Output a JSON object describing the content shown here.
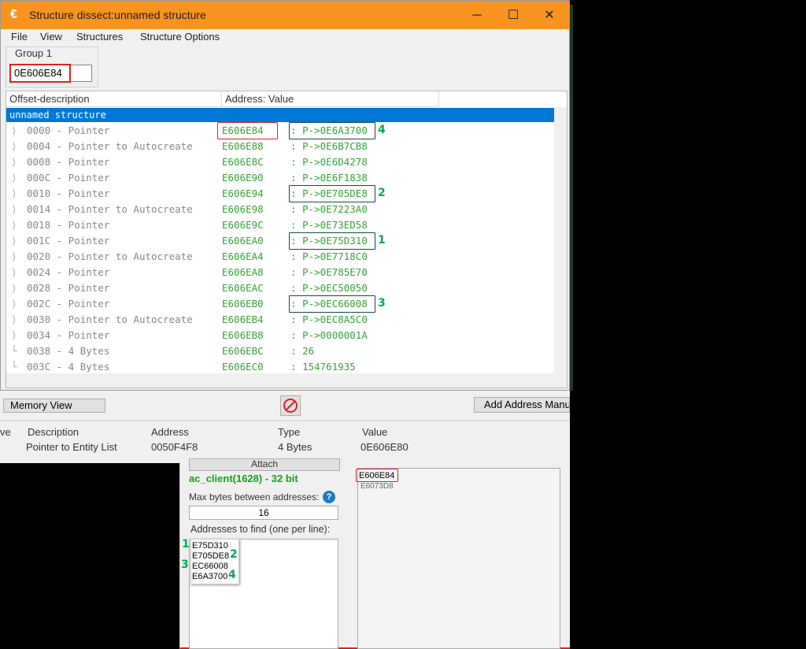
{
  "window": {
    "title": "Structure dissect:unnamed structure",
    "app_icon": "cheat-engine-icon",
    "min_glyph": "─",
    "max_glyph": "☐",
    "close_glyph": "✕"
  },
  "menu": [
    "File",
    "View",
    "Structures",
    "Structure Options"
  ],
  "group": {
    "label": "Group 1",
    "address": "0E606E84"
  },
  "grid": {
    "headers": [
      "Offset-description",
      "Address: Value"
    ],
    "selected_row": "unnamed structure",
    "rows": [
      {
        "tree": "⟩",
        "desc": "0000 - Pointer",
        "addr": "E606E84",
        "val": "P->0E6A3700"
      },
      {
        "tree": "⟩",
        "desc": "0004 - Pointer to Autocreate",
        "addr": "E606E88",
        "val": "P->0E6B7CB8"
      },
      {
        "tree": "⟩",
        "desc": "0008 - Pointer",
        "addr": "E606E8C",
        "val": "P->0E6D4278"
      },
      {
        "tree": "⟩",
        "desc": "000C - Pointer",
        "addr": "E606E90",
        "val": "P->0E6F1838"
      },
      {
        "tree": "⟩",
        "desc": "0010 - Pointer",
        "addr": "E606E94",
        "val": "P->0E705DE8"
      },
      {
        "tree": "⟩",
        "desc": "0014 - Pointer to Autocreate",
        "addr": "E606E98",
        "val": "P->0E7223A0"
      },
      {
        "tree": "⟩",
        "desc": "0018 - Pointer",
        "addr": "E606E9C",
        "val": "P->0E73ED58"
      },
      {
        "tree": "⟩",
        "desc": "001C - Pointer",
        "addr": "E606EA0",
        "val": "P->0E75D310"
      },
      {
        "tree": "⟩",
        "desc": "0020 - Pointer to Autocreate",
        "addr": "E606EA4",
        "val": "P->0E7718C0"
      },
      {
        "tree": "⟩",
        "desc": "0024 - Pointer",
        "addr": "E606EA8",
        "val": "P->0E785E70"
      },
      {
        "tree": "⟩",
        "desc": "0028 - Pointer",
        "addr": "E606EAC",
        "val": "P->0EC50050"
      },
      {
        "tree": "⟩",
        "desc": "002C - Pointer",
        "addr": "E606EB0",
        "val": "P->0EC66008"
      },
      {
        "tree": "⟩",
        "desc": "0030 - Pointer to Autocreate",
        "addr": "E606EB4",
        "val": "P->0EC8A5C0"
      },
      {
        "tree": "⟩",
        "desc": "0034 - Pointer",
        "addr": "E606EB8",
        "val": "P->0000001A"
      },
      {
        "tree": "└",
        "desc": "0038 - 4 Bytes",
        "addr": "E606EBC",
        "val": "26"
      },
      {
        "tree": "└",
        "desc": "003C - 4 Bytes",
        "addr": "E606EC0",
        "val": "154761935"
      }
    ],
    "addr_sep": ":",
    "annotations": [
      "4",
      "2",
      "1",
      "3"
    ]
  },
  "main": {
    "memory_view_label": "Memory View",
    "add_address_label": "Add Address Manually",
    "headers": [
      "ve",
      "Description",
      "Address",
      "Type",
      "Value"
    ],
    "row": [
      "Pointer to Entity List",
      "0050F4F8",
      "4 Bytes",
      "0E606E80"
    ]
  },
  "scanner": {
    "attach_label": "Attach",
    "process": "ac_client(1628) - 32 bit",
    "max_bytes_label": "Max bytes between addresses:",
    "help_glyph": "?",
    "max_bytes_value": "16",
    "find_label": "Addresses to find (one per line):",
    "find_items": [
      "E75D310",
      "E705DE8",
      "EC66008",
      "E6A3700"
    ],
    "find_numbers": [
      "1",
      "2",
      "3",
      "4"
    ],
    "results": [
      "E606E84",
      "E6073D8"
    ]
  },
  "colors": {
    "accent": "#f7931e",
    "value_green": "#3aa13a",
    "highlight_red": "#e02020",
    "selection": "#0078d7"
  }
}
